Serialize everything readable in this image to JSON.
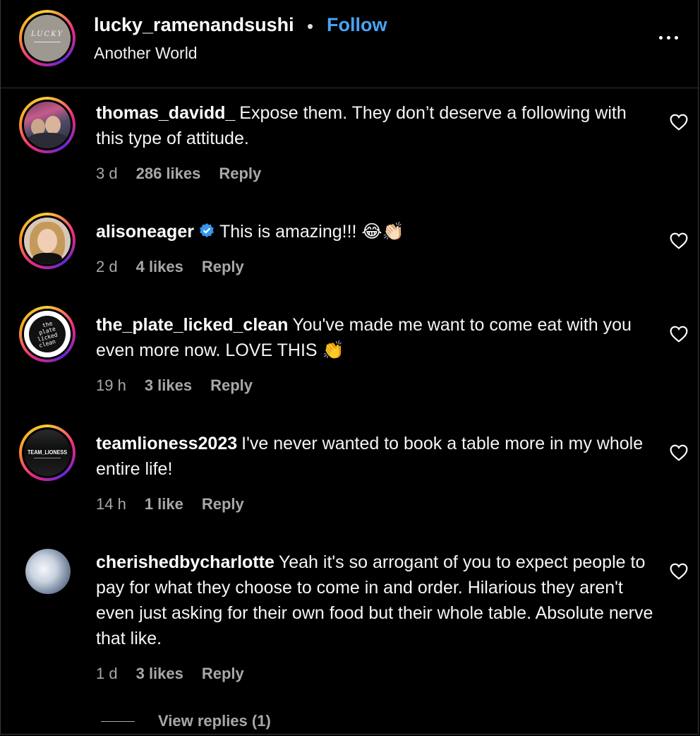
{
  "post": {
    "username": "lucky_ramenandsushi",
    "separator": "•",
    "follow_label": "Follow",
    "subtitle": "Another World",
    "avatar_logo_text": "LUCKY",
    "more_icon": "more-horizontal-icon"
  },
  "comments": [
    {
      "username": "thomas_davidd_",
      "verified": false,
      "text": "Expose them. They don’t deserve a following with this type of attitude.",
      "time": "3 d",
      "likes": "286 likes",
      "reply": "Reply"
    },
    {
      "username": "alisoneager",
      "verified": true,
      "text": "This is amazing!!! 😂👏🏻",
      "time": "2 d",
      "likes": "4 likes",
      "reply": "Reply"
    },
    {
      "username": "the_plate_licked_clean",
      "verified": false,
      "text": "You've made me want to come eat with you even more now. LOVE THIS 👏",
      "time": "19 h",
      "likes": "3 likes",
      "reply": "Reply",
      "avatar_text": [
        "the",
        "plate",
        "licked",
        "clean"
      ]
    },
    {
      "username": "teamlioness2023",
      "verified": false,
      "text": "I've never wanted to book a table more in my whole entire life!",
      "time": "14 h",
      "likes": "1 like",
      "reply": "Reply",
      "avatar_text": [
        "TEAM_LIONESS"
      ]
    },
    {
      "username": "cherishedbycharlotte",
      "verified": false,
      "text": "Yeah it's so arrogant of you to expect people to pay for what they choose to come in and order. Hilarious they aren't even just asking for their own food but their whole table. Absolute nerve that like.",
      "time": "1 d",
      "likes": "3 likes",
      "reply": "Reply"
    }
  ],
  "view_replies_label": "View replies (1)",
  "colors": {
    "background": "#000000",
    "follow": "#4aa3f5",
    "meta": "#a8a8a8",
    "verified": "#3797f0"
  }
}
